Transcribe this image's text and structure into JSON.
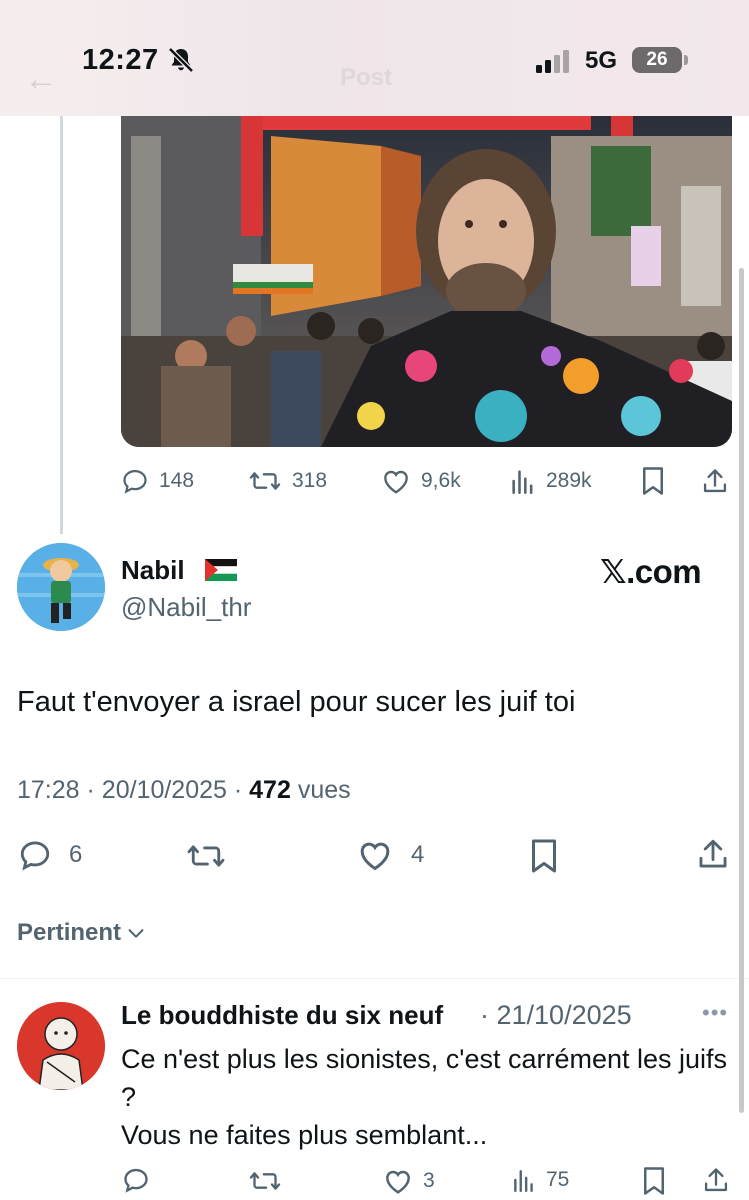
{
  "status_bar": {
    "time": "12:27",
    "network": "5G",
    "battery": "26"
  },
  "header": {
    "title": "Post"
  },
  "quoted_post": {
    "stats": {
      "replies": "148",
      "reposts": "318",
      "likes": "9,6k",
      "views": "289k"
    }
  },
  "main_post": {
    "author_name": "Nabil",
    "handle": "@Nabil_thr",
    "source_badge": "𝕏.com",
    "text": "Faut t'envoyer a israel pour sucer les juif toi",
    "time": "17:28",
    "date": "20/10/2025",
    "views_count": "472",
    "views_label": "vues",
    "stats": {
      "replies": "6",
      "likes": "4"
    }
  },
  "sort": {
    "label": "Pertinent"
  },
  "comment": {
    "author_name": "Le bouddhiste du six neuf",
    "date": "21/10/2025",
    "more": "•••",
    "text_line1": "Ce n'est plus les sionistes, c'est carrément les juifs ?",
    "text_line2": "Vous ne faites plus semblant...",
    "stats": {
      "likes": "3",
      "views": "75"
    }
  },
  "colors": {
    "secondary_text": "#536471",
    "primary_text": "#0f1419",
    "divider": "#eff3f4"
  }
}
